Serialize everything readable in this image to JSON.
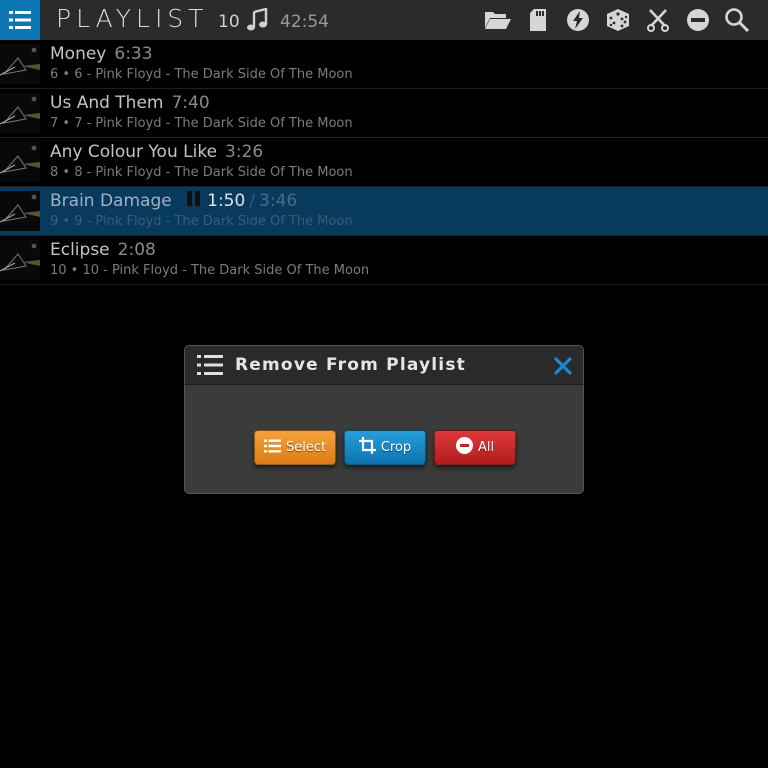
{
  "header": {
    "title": "PLAYLIST",
    "track_count": "10",
    "total_duration": "42:54",
    "icons": [
      "menu-icon",
      "music-note-icon",
      "folder-open-icon",
      "sd-card-icon",
      "lightning-icon",
      "dice-icon",
      "scissors-icon",
      "minus-circle-icon",
      "search-icon"
    ],
    "accent_color": "#0c77b4"
  },
  "tracks": [
    {
      "title": "Money",
      "duration": "6:33",
      "meta": "6 • 6 - Pink Floyd - The Dark Side Of The Moon"
    },
    {
      "title": "Us And Them",
      "duration": "7:40",
      "meta": "7 • 7 - Pink Floyd - The Dark Side Of The Moon"
    },
    {
      "title": "Any Colour You Like",
      "duration": "3:26",
      "meta": "8 • 8 - Pink Floyd - The Dark Side Of The Moon"
    },
    {
      "title": "Brain Damage",
      "elapsed": "1:50",
      "separator": "/",
      "duration": "3:46",
      "meta": "9 • 9 - Pink Floyd - The Dark Side Of The Moon",
      "state": "paused"
    },
    {
      "title": "Eclipse",
      "duration": "2:08",
      "meta": "10 • 10 - Pink Floyd - The Dark Side Of The Moon"
    }
  ],
  "dialog": {
    "title": "Remove From Playlist",
    "buttons": {
      "select": "Select",
      "crop": "Crop",
      "all": "All"
    },
    "button_colors": {
      "select": "#e88d25",
      "crop": "#1887c4",
      "all": "#c82a2a"
    }
  }
}
